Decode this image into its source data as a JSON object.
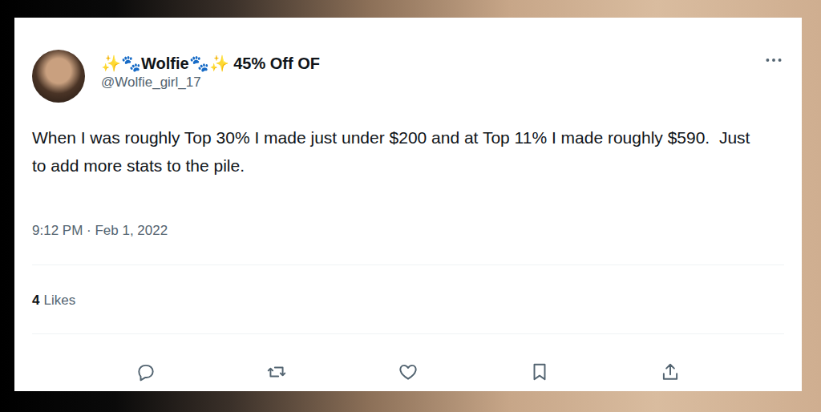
{
  "tweet": {
    "display_name": "✨🐾Wolfie🐾✨ 45% Off OF",
    "handle": "@Wolfie_girl_17",
    "text": "When I was roughly Top 30% I made just under $200 and at Top 11% I made roughly $590.  Just to add more stats to the pile.",
    "timestamp": "9:12 PM · Feb 1, 2022",
    "likes_count": "4",
    "likes_label": "Likes"
  }
}
